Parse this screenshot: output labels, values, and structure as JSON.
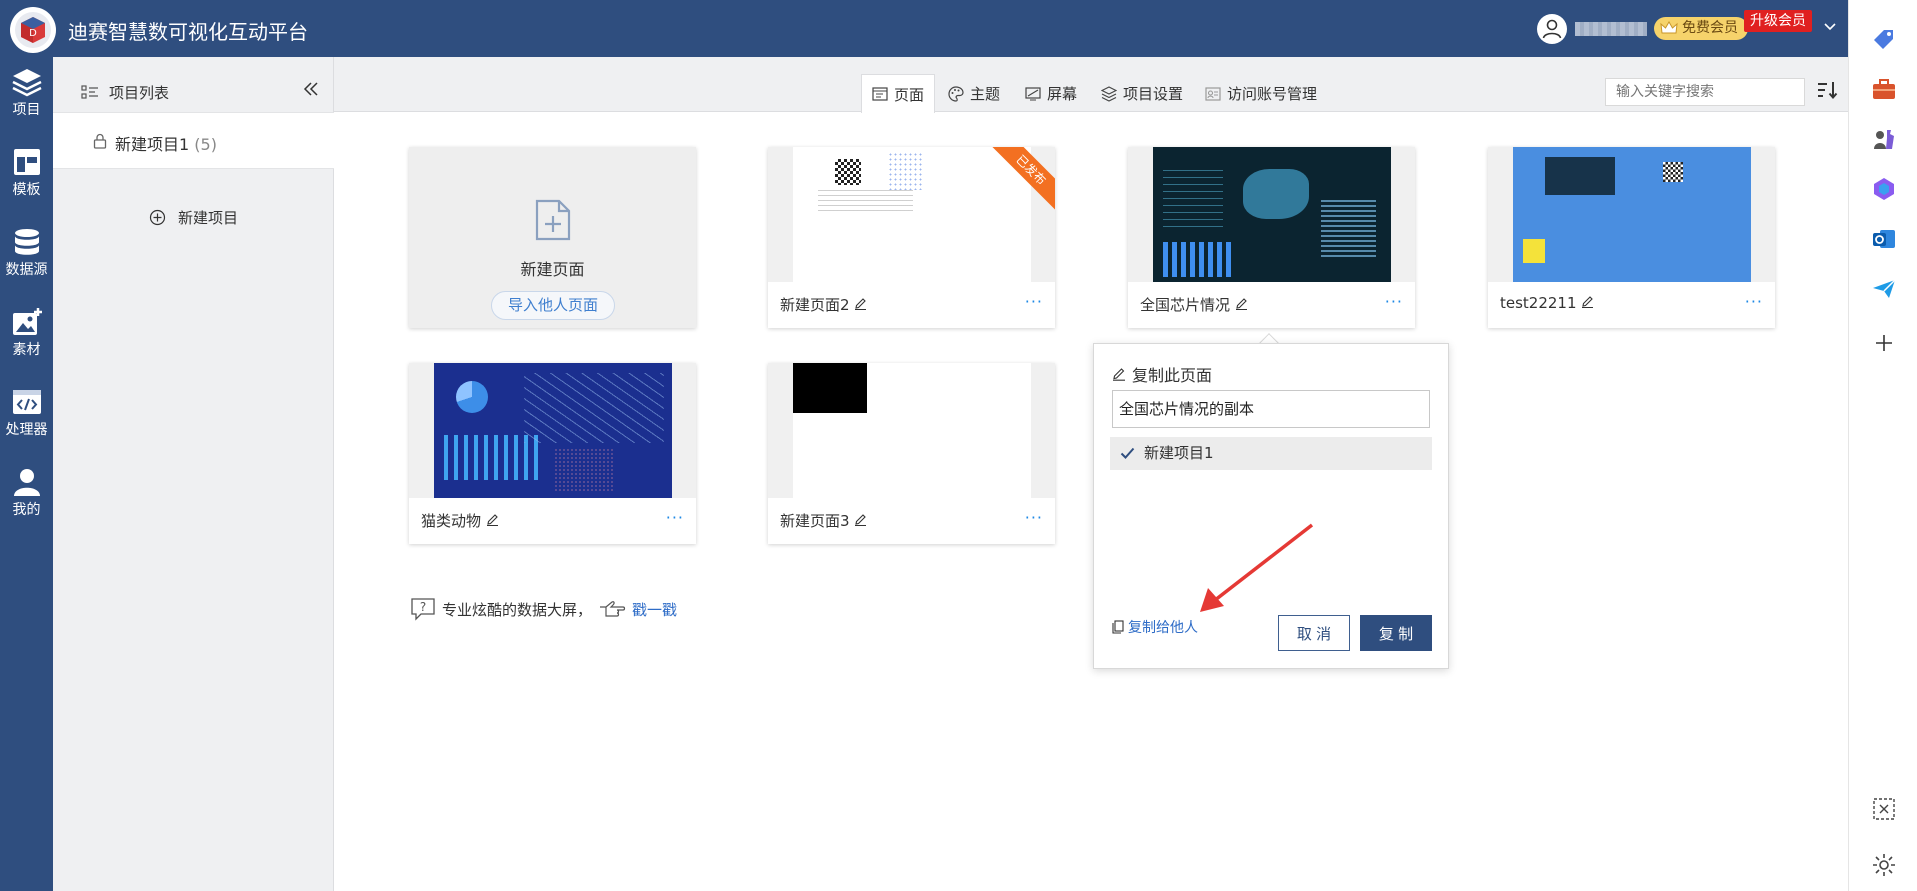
{
  "app": {
    "title": "迪赛智慧数可视化互动平台"
  },
  "topbar": {
    "free_member": "免费会员",
    "upgrade": "升级会员"
  },
  "left_nav": [
    {
      "label": "项目",
      "icon": "layers-icon"
    },
    {
      "label": "模板",
      "icon": "template-icon"
    },
    {
      "label": "数据源",
      "icon": "database-icon"
    },
    {
      "label": "素材",
      "icon": "image-add-icon"
    },
    {
      "label": "处理器",
      "icon": "code-icon"
    },
    {
      "label": "我的",
      "icon": "user-icon"
    }
  ],
  "project_panel": {
    "header": "项目列表",
    "project": {
      "name": "新建项目1",
      "count": "(5)"
    },
    "add_label": "新建项目"
  },
  "tabs": [
    {
      "label": "页面",
      "icon": "page-icon",
      "active": true
    },
    {
      "label": "主题",
      "icon": "palette-icon"
    },
    {
      "label": "屏幕",
      "icon": "screen-icon"
    },
    {
      "label": "项目设置",
      "icon": "stack-icon"
    },
    {
      "label": "访问账号管理",
      "icon": "account-icon"
    }
  ],
  "search": {
    "placeholder": "输入关键字搜索"
  },
  "new_page_card": {
    "label": "新建页面",
    "import_label": "导入他人页面"
  },
  "cards": [
    {
      "name": "新建页面2",
      "badge": "已发布",
      "more": "···"
    },
    {
      "name": "全国芯片情况",
      "more": "···"
    },
    {
      "name": "test22211",
      "more": "···"
    },
    {
      "name": "猫类动物",
      "more": "···"
    },
    {
      "name": "新建页面3",
      "more": "···"
    }
  ],
  "tip": {
    "text": "专业炫酷的数据大屏，",
    "link": "戳一戳"
  },
  "copy_popover": {
    "title": "复制此页面",
    "name_value": "全国芯片情况的副本",
    "target_project": "新建项目1",
    "copy_to_others": "复制给他人",
    "cancel": "取 消",
    "confirm": "复 制"
  },
  "colors": {
    "primary": "#2f4e7f",
    "accent_link": "#2e6cc7",
    "ribbon": "#f37021",
    "annotation_arrow": "#e53935"
  }
}
